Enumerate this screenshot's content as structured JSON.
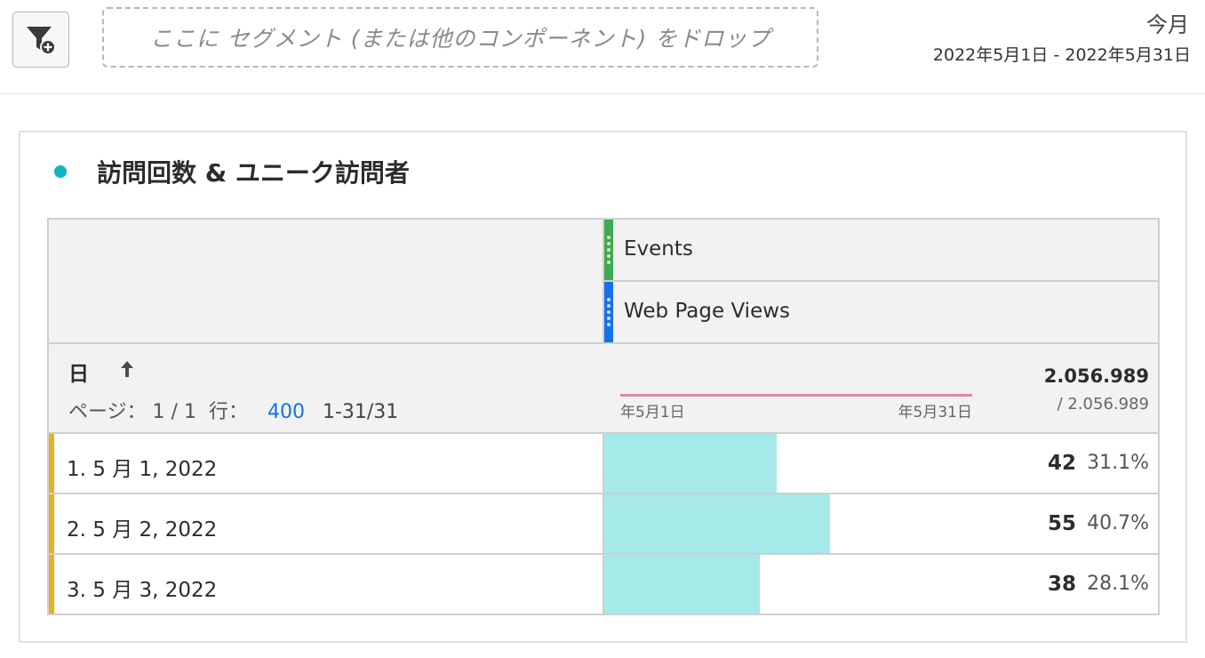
{
  "toolbar": {
    "filter_icon": "segment-filter-icon",
    "dropzone_text": "ここに セグメント (または他のコンポーネント) をドロップ",
    "date_label": "今月",
    "date_range": "2022年5月1日 - 2022年5月31日"
  },
  "panel": {
    "title": "訪問回数 & ユニーク訪問者",
    "dot_color": "#12b5c0"
  },
  "table": {
    "metrics": [
      {
        "label": "Events",
        "color": "#3dab4e"
      },
      {
        "label": "Web Page Views",
        "color": "#1473e6"
      }
    ],
    "dimension": "日",
    "sort_icon": "arrow-up-icon",
    "pager": {
      "page_text": "ページ： 1 / 1",
      "rows_text": "行：",
      "rows_value": "400",
      "range": "1-31/31"
    },
    "sparkline": {
      "start_label": "年5月1日",
      "end_label": "年5月31日",
      "color": "#e0869c"
    },
    "total": "2.056.989",
    "total_sub": "/ 2.056.989",
    "rows": [
      {
        "label": "1.  5 月 1, 2022",
        "value": "42",
        "pct": "31.1%",
        "share": 0.311
      },
      {
        "label": "2.  5 月 2, 2022",
        "value": "55",
        "pct": "40.7%",
        "share": 0.407
      },
      {
        "label": "3.  5 月 3, 2022",
        "value": "38",
        "pct": "28.1%",
        "share": 0.281
      }
    ],
    "row_accent": "#e5b224",
    "bar_color": "#a5e9e9"
  }
}
